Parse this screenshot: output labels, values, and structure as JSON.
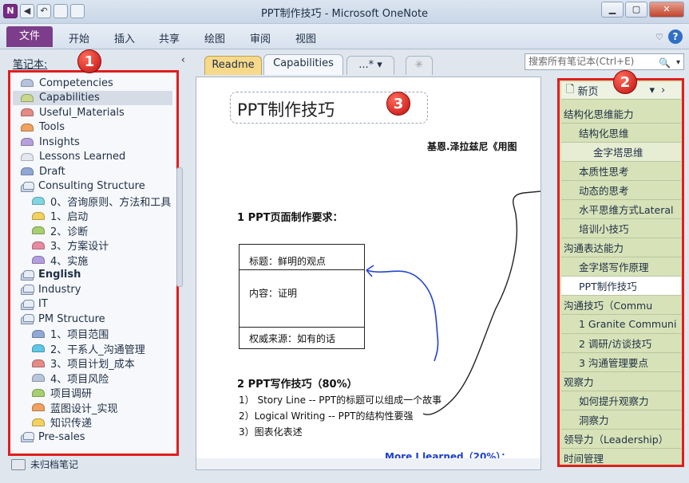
{
  "window": {
    "title": "PPT制作技巧 - Microsoft OneNote",
    "app_icon": "N"
  },
  "qat": {
    "undo_glyph": "↶",
    "back_glyph": "◀"
  },
  "ribbon": {
    "file": "文件",
    "tabs": [
      "开始",
      "插入",
      "共享",
      "绘图",
      "审阅",
      "视图"
    ]
  },
  "notebook_panel": {
    "title": "笔记本:",
    "items": [
      {
        "label": "Competencies",
        "color": "#b6c3dd",
        "kind": "section",
        "level": 0
      },
      {
        "label": "Capabilities",
        "color": "#c9d98c",
        "kind": "section",
        "level": 0,
        "selected": true
      },
      {
        "label": "Useful_Materials",
        "color": "#e58a86",
        "kind": "section",
        "level": 0
      },
      {
        "label": "Tools",
        "color": "#f0a15f",
        "kind": "section",
        "level": 0
      },
      {
        "label": "Insights",
        "color": "#b89fdc",
        "kind": "section",
        "level": 0
      },
      {
        "label": "Lessons Learned",
        "color": "#e3e7ee",
        "kind": "section",
        "level": 0
      },
      {
        "label": "Draft",
        "color": "#8fa8d6",
        "kind": "section",
        "level": 0
      },
      {
        "label": "Consulting Structure",
        "kind": "group",
        "level": 0
      },
      {
        "label": "0、咨询原则、方法和工具",
        "color": "#7fd6e0",
        "kind": "section",
        "level": 1
      },
      {
        "label": "1、启动",
        "color": "#f3d15f",
        "kind": "section",
        "level": 1
      },
      {
        "label": "2、诊断",
        "color": "#a8cf6e",
        "kind": "section",
        "level": 1
      },
      {
        "label": "3、方案设计",
        "color": "#e88aa0",
        "kind": "section",
        "level": 1
      },
      {
        "label": "4、实施",
        "color": "#b39ee0",
        "kind": "section",
        "level": 1
      },
      {
        "label": "English",
        "kind": "group",
        "level": 0,
        "bold": true
      },
      {
        "label": "Industry",
        "kind": "group",
        "level": 0
      },
      {
        "label": "IT",
        "kind": "group",
        "level": 0
      },
      {
        "label": "PM Structure",
        "kind": "group",
        "level": 0
      },
      {
        "label": "1、项目范围",
        "color": "#8fa8d6",
        "kind": "section",
        "level": 1
      },
      {
        "label": "2、干系人_沟通管理",
        "color": "#5fc7e6",
        "kind": "section",
        "level": 1
      },
      {
        "label": "3、项目计划_成本",
        "color": "#e58a86",
        "kind": "section",
        "level": 1
      },
      {
        "label": "4、项目风险",
        "color": "#b8c6dc",
        "kind": "section",
        "level": 1
      },
      {
        "label": "项目调研",
        "color": "#a8cf6e",
        "kind": "section",
        "level": 1
      },
      {
        "label": "蓝图设计_实现",
        "color": "#f0a15f",
        "kind": "section",
        "level": 1
      },
      {
        "label": "知识传递",
        "color": "#f3d15f",
        "kind": "section",
        "level": 1
      },
      {
        "label": "Pre-sales",
        "kind": "group",
        "level": 0
      }
    ],
    "unfiled": "未归档笔记"
  },
  "section_tabs": {
    "readme": "Readme",
    "capabilities": "Capabilities",
    "more": "...*",
    "new": "✳"
  },
  "search": {
    "placeholder": "搜索所有笔记本(Ctrl+E)"
  },
  "page": {
    "title": "PPT制作技巧",
    "author_line": "基恩.泽拉兹尼《用图",
    "heading1": "1 PPT页面制作要求：",
    "box": {
      "title": "标题：鲜明的观点",
      "content": "内容：证明",
      "source": "权威来源：如有的话"
    },
    "heading2": "2 PPT写作技巧（80%）",
    "list": [
      "1） Story Line -- PPT的标题可以组成一个故事",
      "2）Logical Writing -- PPT的结构性要强",
      "3）图表化表述"
    ],
    "more_learned": "More I learned（20%）："
  },
  "pages_panel": {
    "new_page": "新页",
    "items": [
      {
        "label": "结构化思维能力",
        "level": 0
      },
      {
        "label": "结构化思维",
        "level": 1
      },
      {
        "label": "金字塔思维",
        "level": 2
      },
      {
        "label": "本质性思考",
        "level": 1
      },
      {
        "label": "动态的思考",
        "level": 1
      },
      {
        "label": "水平思维方式Lateral",
        "level": 1
      },
      {
        "label": "培训小技巧",
        "level": 1
      },
      {
        "label": "沟通表达能力",
        "level": 0
      },
      {
        "label": "金字塔写作原理",
        "level": 1
      },
      {
        "label": "PPT制作技巧",
        "level": 1,
        "selected": true
      },
      {
        "label": "沟通技巧（Commu",
        "level": 0
      },
      {
        "label": "1 Granite Communi",
        "level": 1
      },
      {
        "label": "2 调研/访谈技巧",
        "level": 1
      },
      {
        "label": "3 沟通管理要点",
        "level": 1
      },
      {
        "label": "观察力",
        "level": 0
      },
      {
        "label": "如何提升观察力",
        "level": 1
      },
      {
        "label": "洞察力",
        "level": 1
      },
      {
        "label": "领导力（Leadership）",
        "level": 0
      },
      {
        "label": "时间管理",
        "level": 0
      }
    ]
  },
  "badges": [
    "1",
    "2",
    "3"
  ],
  "colors": {
    "highlight": "#e01e1e",
    "ribbon_file": "#7c3d8a",
    "page_list_bg": "#d7e2b8"
  }
}
